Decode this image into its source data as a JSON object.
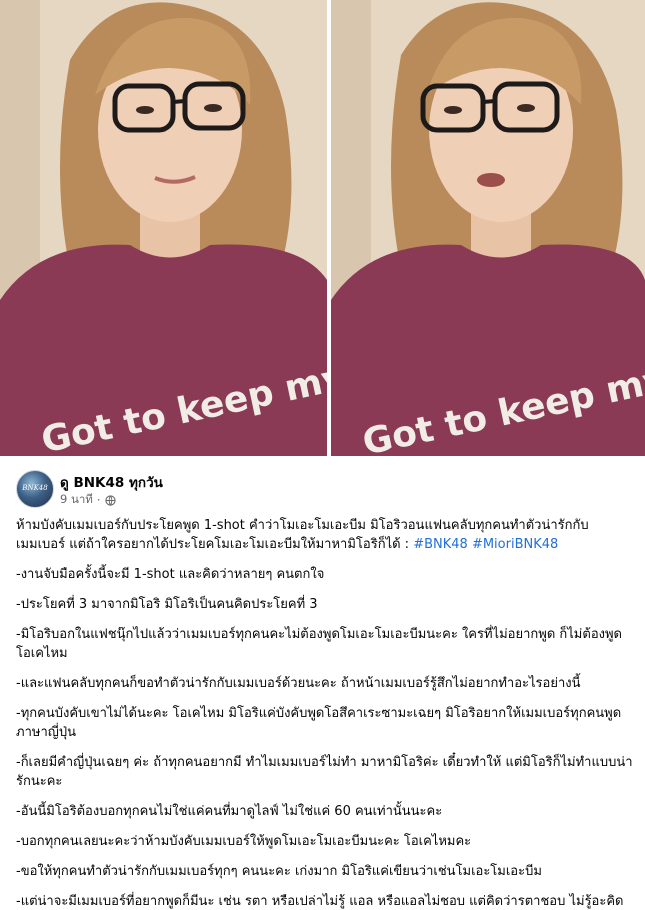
{
  "post": {
    "author": "ดู BNK48 ทุกวัน",
    "time": "9 นาที",
    "separator": "·",
    "avatar_text": "BNK48",
    "intro": "ห้ามบังคับเมมเบอร์กับประโยคพูด 1-shot คำว่าโมเอะโมเอะบีม มิโอริวอนแฟนคลับทุกคนทำตัวน่ารักกับเมมเบอร์ แต่ถ้าใครอยากได้ประโยคโมเอะโมเอะบีมให้มาหามิโอริก็ได้ : ",
    "hashtags": [
      "#BNK48",
      "#MioriBNK48"
    ],
    "lines": [
      "-งานจับมือครั้งนี้จะมี 1-shot และคิดว่าหลายๆ คนตกใจ",
      "-ประโยคที่ 3 มาจากมิโอริ มิโอริเป็นคนคิดประโยคที่ 3",
      "-มิโอริบอกในแฟชนุ๊กไปแล้วว่าเมมเบอร์ทุกคนคะไม่ต้องพูดโมเอะโมเอะบีมนะคะ ใครที่ไม่อยากพูด ก็ไม่ต้องพูด โอเคไหม",
      "-และแฟนคลับทุกคนก็ขอทำตัวน่ารักกับเมมเบอร์ด้วยนะคะ ถ้าหน้าเมมเบอร์รู้สึกไม่อยากทำอะไรอย่างนี้",
      "-ทุกคนบังคับเขาไม่ได้นะคะ โอเคไหม มิโอริแค่บังคับพูดโอสึคาเระซามะเฉยๆ มิโอริอยากให้เมมเบอร์ทุกคนพูดภาษาญี่ปุ่น",
      "-ก็เลยมีคำญี่ปุ่นเฉยๆ ค่ะ ถ้าทุกคนอยากมี ทำไมเมมเบอร์ไม่ทำ มาหามิโอริค่ะ เดี๋ยวทำให้ แต่มิโอริก็ไม่ทำแบบน่ารักนะคะ",
      "-อันนี้มิโอริต้องบอกทุกคนไม่ใช่แค่คนที่มาดูไลฟ์ ไม่ใช่แค่ 60 คนเท่านั้นนะคะ",
      "-บอกทุกคนเลยนะคะว่าห้ามบังคับเมมเบอร์ให้พูดโมเอะโมเอะบีมนะคะ โอเคไหมคะ",
      "-ขอให้ทุกคนทำตัวน่ารักกับเมมเบอร์ทุกๆ คนนะคะ เก่งมาก มิโอริแค่เขียนว่าเช่นโมเอะโมเอะบีม",
      "-แต่น่าจะมีเมมเบอร์ที่อยากพูดก็มีนะ เช่น รตา หรือเปล่าไม่รู้ แอล หรือแอลไม่ชอบ แต่คิดว่ารตาชอบ ไม่รู้อะคิดเอง"
    ]
  },
  "photo": {
    "shirt_text": "Got to keep my coo"
  },
  "colors": {
    "link": "#216fdb",
    "meta": "#65676b",
    "shirt": "#8a3a55"
  }
}
